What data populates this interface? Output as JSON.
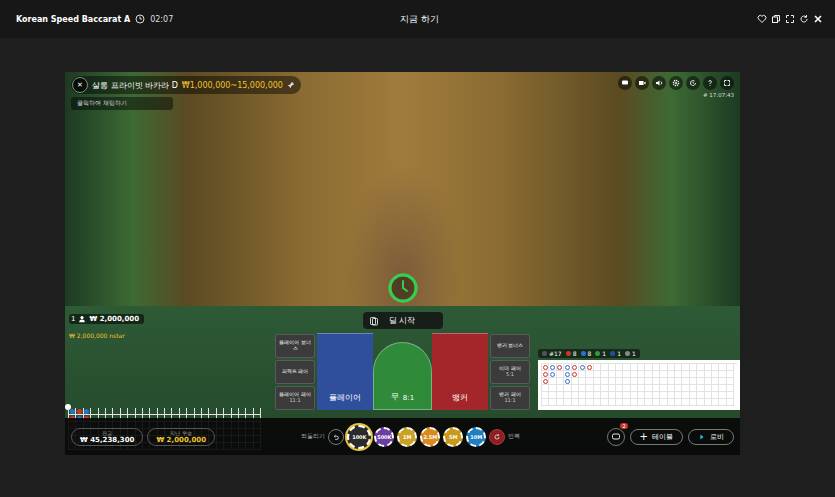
{
  "topbar": {
    "title": "Korean Speed Baccarat A",
    "time": "02:07",
    "center": "지금 하기"
  },
  "table": {
    "close": "✕",
    "name": "살롱 프라이빗 바카라 D",
    "limits": "₩1,000,000~15,000,000",
    "chat_hint": "클릭하여 채팅하기",
    "clock": "# 17:07:43"
  },
  "timer": {
    "level": 1
  },
  "deal_button": "딜 시작",
  "player_bet": {
    "seat": "1",
    "amount": "₩ 2,000,000",
    "name": "₩ 2,000,000 nstar"
  },
  "side_bets_left": [
    {
      "label": "플레이어 보너스"
    },
    {
      "label": "퍼펙트 페어"
    },
    {
      "label": "플레이어 페어",
      "odds": "11:1"
    }
  ],
  "main_bets": [
    {
      "label": "플레이어",
      "color": "#2f4f9c",
      "kind": "side"
    },
    {
      "label": "무",
      "odds": "8:1",
      "color": "#2f8a3a",
      "kind": "arch"
    },
    {
      "label": "뱅커",
      "color": "#a3262a",
      "kind": "side"
    }
  ],
  "side_bets_right": [
    {
      "label": "뱅커 보너스"
    },
    {
      "label": "이더 페어",
      "odds": "5:1"
    },
    {
      "label": "뱅커 페어",
      "odds": "11:1"
    }
  ],
  "bead_road": [
    {
      "color": "#2f6fd0"
    },
    {
      "color": "#d0342c"
    },
    {
      "color": "#d0342c"
    },
    {
      "color": "#2f6fd0"
    },
    {
      "color": "#d0342c"
    },
    {
      "color": "#2f6fd0"
    },
    {
      "color": "#d0342c"
    },
    {
      "color": "#2f6fd0"
    },
    {
      "color": "#2f6fd0"
    },
    {
      "color": "#d0342c"
    },
    {
      "color": "#2f6fd0"
    },
    {
      "color": "#d0342c"
    },
    {
      "color": "#2f6fd0"
    },
    {
      "color": "#d0342c"
    },
    {
      "color": "#2f6fd0"
    },
    {
      "color": "#2f6fd0"
    },
    {
      "color": "#d0342c"
    }
  ],
  "big_road": [
    [
      "#d0342c",
      "#d0342c",
      "#d0342c"
    ],
    [
      "#2f6fd0",
      "#2f6fd0"
    ],
    [
      "#d0342c"
    ],
    [
      "#2f6fd0",
      "#2f6fd0",
      "#2f6fd0"
    ],
    [
      "#d0342c",
      "#d0342c"
    ],
    [
      "#2f6fd0"
    ],
    [
      "#d0342c"
    ]
  ],
  "stats": [
    {
      "label": "#17",
      "color": "#555555"
    },
    {
      "label": "8",
      "color": "#d0342c"
    },
    {
      "label": "8",
      "color": "#2f6fd0"
    },
    {
      "label": "1",
      "color": "#2e9a3e"
    },
    {
      "label": "1",
      "color": "#1f4fa0"
    },
    {
      "label": "1",
      "color": "#8a8a8a"
    }
  ],
  "balance": {
    "label": "잔고",
    "value": "₩ 45,238,300"
  },
  "last_win": {
    "label": "지난 우승",
    "value": "₩ 2,000,000"
  },
  "undo": "되돌리기",
  "repeat": "반복",
  "chips": [
    {
      "label": "100K",
      "color": "#2a2a2a",
      "selected": true
    },
    {
      "label": "500K",
      "color": "#6b3fa0",
      "selected": false
    },
    {
      "label": "1M",
      "color": "#c9a227",
      "selected": false
    },
    {
      "label": "2.5M",
      "color": "#d98a1f",
      "selected": false
    },
    {
      "label": "5M",
      "color": "#c99a1a",
      "selected": false
    },
    {
      "label": "10M",
      "color": "#1f7fc0",
      "selected": false
    }
  ],
  "chat_badge": "2",
  "table_button": {
    "icon": "+",
    "label": "테이블"
  },
  "lobby_button": "로비"
}
